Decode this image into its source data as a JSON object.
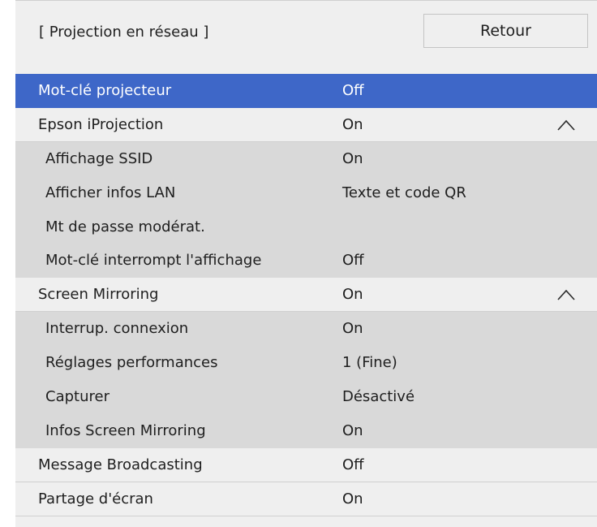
{
  "header": {
    "title": "[ Projection en réseau ]",
    "back_label": "Retour"
  },
  "colors": {
    "selected_row": "#3e67c8",
    "main_row": "#efefef",
    "sub_row": "#d9d9d9"
  },
  "items": [
    {
      "label": "Mot-clé projecteur",
      "value": "Off",
      "kind": "selected"
    },
    {
      "label": "Epson iProjection",
      "value": "On",
      "kind": "main",
      "icon": "chevron-up-icon"
    },
    {
      "label": "Affichage SSID",
      "value": "On",
      "kind": "sub"
    },
    {
      "label": "Afficher infos LAN",
      "value": "Texte et code QR",
      "kind": "sub"
    },
    {
      "label": "Mt de passe modérat.",
      "value": "",
      "kind": "sub"
    },
    {
      "label": "Mot-clé interrompt l'affichage",
      "value": "Off",
      "kind": "sub"
    },
    {
      "label": "Screen Mirroring",
      "value": "On",
      "kind": "main",
      "icon": "chevron-up-icon"
    },
    {
      "label": "Interrup. connexion",
      "value": "On",
      "kind": "sub"
    },
    {
      "label": "Réglages performances",
      "value": "1 (Fine)",
      "kind": "sub"
    },
    {
      "label": "Capturer",
      "value": "Désactivé",
      "kind": "sub"
    },
    {
      "label": "Infos Screen Mirroring",
      "value": "On",
      "kind": "sub"
    },
    {
      "label": "Message Broadcasting",
      "value": "Off",
      "kind": "main"
    },
    {
      "label": "Partage d'écran",
      "value": "On",
      "kind": "main"
    }
  ]
}
